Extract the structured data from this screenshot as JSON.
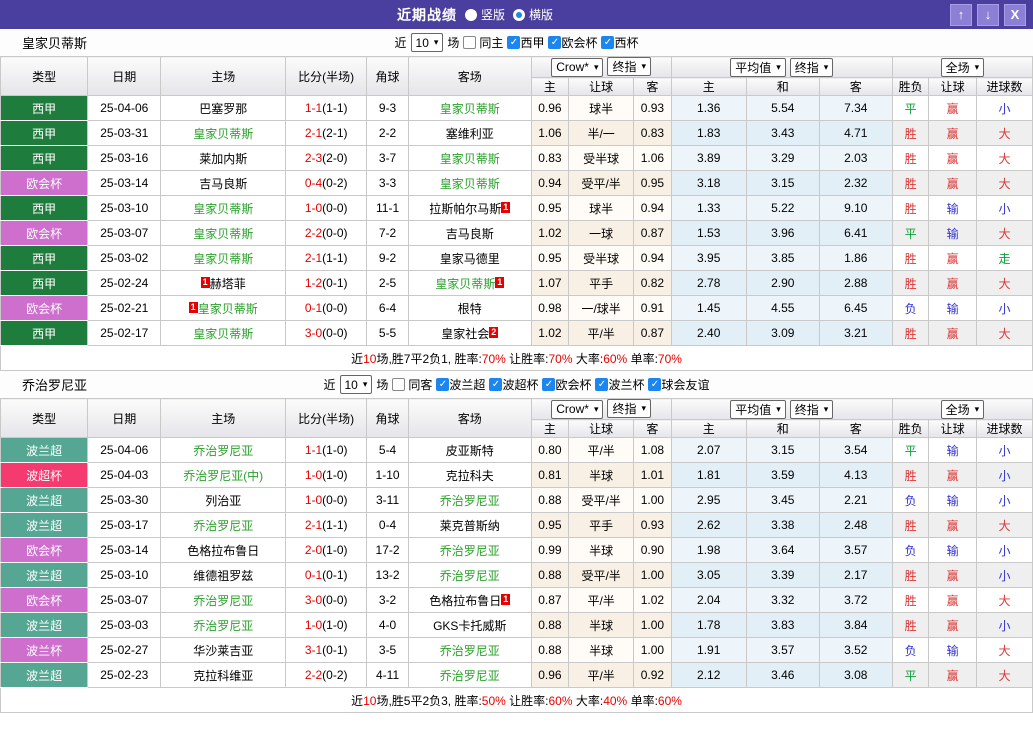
{
  "titlebar": {
    "title": "近期战绩",
    "vertical_label": "竖版",
    "horizontal_label": "横版",
    "vertical_selected": false,
    "horizontal_selected": true,
    "buttons": {
      "up": "↑",
      "down": "↓",
      "close": "X"
    }
  },
  "colors": {
    "titlebar_purple": "#4A3F9E",
    "button_purple": "#8B7FD6",
    "checkbox_blue": "#1C86EE",
    "team_highlight_green": "#2CA02C",
    "score_red": "#E60000",
    "result_red": "#D93636",
    "result_blue": "#3333CC",
    "result_green": "#0E9E3C",
    "league": {
      "西甲": "#1E7C3C",
      "欧会杯": "#CE6FCE",
      "波兰超": "#55A794",
      "波超杯": "#F43A6E",
      "波兰杯": "#CE6FCE"
    }
  },
  "columns": {
    "left": [
      "类型",
      "日期",
      "主场",
      "比分(半场)",
      "角球",
      "客场"
    ],
    "odds": [
      "主",
      "让球",
      "客"
    ],
    "avg": [
      "主",
      "和",
      "客"
    ],
    "result": [
      "胜负",
      "让球",
      "进球数"
    ]
  },
  "sections": [
    {
      "team": "皇家贝蒂斯",
      "filter": {
        "near_label": "近",
        "count": "10",
        "games_label": "场",
        "same_label": "同主",
        "same_checked": false,
        "leagues": [
          "西甲",
          "欧会杯",
          "西杯"
        ]
      },
      "selectors": {
        "odds": [
          "Crow*",
          "终指"
        ],
        "avg": [
          "平均值",
          "终指"
        ],
        "scope": [
          "全场"
        ]
      },
      "rows": [
        {
          "league": "西甲",
          "date": "25-04-06",
          "home": "巴塞罗那",
          "home_card": "",
          "home_self": false,
          "score": "1-1",
          "half": "(1-1)",
          "corner": "9-3",
          "away": "皇家贝蒂斯",
          "away_card": "",
          "away_self": true,
          "odds": [
            "0.96",
            "球半",
            "0.93"
          ],
          "avg": [
            "1.36",
            "5.54",
            "7.34"
          ],
          "res": [
            [
              "平",
              "g"
            ],
            [
              "赢",
              "r"
            ],
            [
              "小",
              "b"
            ]
          ]
        },
        {
          "league": "西甲",
          "date": "25-03-31",
          "home": "皇家贝蒂斯",
          "home_card": "",
          "home_self": true,
          "score": "2-1",
          "half": "(2-1)",
          "corner": "2-2",
          "away": "塞维利亚",
          "away_card": "",
          "away_self": false,
          "odds": [
            "1.06",
            "半/一",
            "0.83"
          ],
          "avg": [
            "1.83",
            "3.43",
            "4.71"
          ],
          "res": [
            [
              "胜",
              "r"
            ],
            [
              "赢",
              "r"
            ],
            [
              "大",
              "r"
            ]
          ]
        },
        {
          "league": "西甲",
          "date": "25-03-16",
          "home": "莱加内斯",
          "home_card": "",
          "home_self": false,
          "score": "2-3",
          "half": "(2-0)",
          "corner": "3-7",
          "away": "皇家贝蒂斯",
          "away_card": "",
          "away_self": true,
          "odds": [
            "0.83",
            "受半球",
            "1.06"
          ],
          "avg": [
            "3.89",
            "3.29",
            "2.03"
          ],
          "res": [
            [
              "胜",
              "r"
            ],
            [
              "赢",
              "r"
            ],
            [
              "大",
              "r"
            ]
          ]
        },
        {
          "league": "欧会杯",
          "date": "25-03-14",
          "home": "吉马良斯",
          "home_card": "",
          "home_self": false,
          "score": "0-4",
          "half": "(0-2)",
          "corner": "3-3",
          "away": "皇家贝蒂斯",
          "away_card": "",
          "away_self": true,
          "odds": [
            "0.94",
            "受平/半",
            "0.95"
          ],
          "avg": [
            "3.18",
            "3.15",
            "2.32"
          ],
          "res": [
            [
              "胜",
              "r"
            ],
            [
              "赢",
              "r"
            ],
            [
              "大",
              "r"
            ]
          ]
        },
        {
          "league": "西甲",
          "date": "25-03-10",
          "home": "皇家贝蒂斯",
          "home_card": "",
          "home_self": true,
          "score": "1-0",
          "half": "(0-0)",
          "corner": "11-1",
          "away": "拉斯帕尔马斯",
          "away_card": "1",
          "away_self": false,
          "odds": [
            "0.95",
            "球半",
            "0.94"
          ],
          "avg": [
            "1.33",
            "5.22",
            "9.10"
          ],
          "res": [
            [
              "胜",
              "r"
            ],
            [
              "输",
              "b"
            ],
            [
              "小",
              "b"
            ]
          ]
        },
        {
          "league": "欧会杯",
          "date": "25-03-07",
          "home": "皇家贝蒂斯",
          "home_card": "",
          "home_self": true,
          "score": "2-2",
          "half": "(0-0)",
          "corner": "7-2",
          "away": "吉马良斯",
          "away_card": "",
          "away_self": false,
          "odds": [
            "1.02",
            "一球",
            "0.87"
          ],
          "avg": [
            "1.53",
            "3.96",
            "6.41"
          ],
          "res": [
            [
              "平",
              "g"
            ],
            [
              "输",
              "b"
            ],
            [
              "大",
              "r"
            ]
          ]
        },
        {
          "league": "西甲",
          "date": "25-03-02",
          "home": "皇家贝蒂斯",
          "home_card": "",
          "home_self": true,
          "score": "2-1",
          "half": "(1-1)",
          "corner": "9-2",
          "away": "皇家马德里",
          "away_card": "",
          "away_self": false,
          "odds": [
            "0.95",
            "受半球",
            "0.94"
          ],
          "avg": [
            "3.95",
            "3.85",
            "1.86"
          ],
          "res": [
            [
              "胜",
              "r"
            ],
            [
              "赢",
              "r"
            ],
            [
              "走",
              "g"
            ]
          ]
        },
        {
          "league": "西甲",
          "date": "25-02-24",
          "home": "赫塔菲",
          "home_card": "1",
          "home_self": false,
          "score": "1-2",
          "half": "(0-1)",
          "corner": "2-5",
          "away": "皇家贝蒂斯",
          "away_card": "1",
          "away_self": true,
          "odds": [
            "1.07",
            "平手",
            "0.82"
          ],
          "avg": [
            "2.78",
            "2.90",
            "2.88"
          ],
          "res": [
            [
              "胜",
              "r"
            ],
            [
              "赢",
              "r"
            ],
            [
              "大",
              "r"
            ]
          ]
        },
        {
          "league": "欧会杯",
          "date": "25-02-21",
          "home": "皇家贝蒂斯",
          "home_card": "1",
          "home_self": true,
          "score": "0-1",
          "half": "(0-0)",
          "corner": "6-4",
          "away": "根特",
          "away_card": "",
          "away_self": false,
          "odds": [
            "0.98",
            "一/球半",
            "0.91"
          ],
          "avg": [
            "1.45",
            "4.55",
            "6.45"
          ],
          "res": [
            [
              "负",
              "b"
            ],
            [
              "输",
              "b"
            ],
            [
              "小",
              "b"
            ]
          ]
        },
        {
          "league": "西甲",
          "date": "25-02-17",
          "home": "皇家贝蒂斯",
          "home_card": "",
          "home_self": true,
          "score": "3-0",
          "half": "(0-0)",
          "corner": "5-5",
          "away": "皇家社会",
          "away_card": "2",
          "away_self": false,
          "odds": [
            "1.02",
            "平/半",
            "0.87"
          ],
          "avg": [
            "2.40",
            "3.09",
            "3.21"
          ],
          "res": [
            [
              "胜",
              "r"
            ],
            [
              "赢",
              "r"
            ],
            [
              "大",
              "r"
            ]
          ]
        }
      ],
      "summary": [
        {
          "t": "近",
          "red": false
        },
        {
          "t": "10",
          "red": true
        },
        {
          "t": "场,胜7平2负1, 胜率:",
          "red": false
        },
        {
          "t": "70%",
          "red": true
        },
        {
          "t": " 让胜率:",
          "red": false
        },
        {
          "t": "70%",
          "red": true
        },
        {
          "t": " 大率:",
          "red": false
        },
        {
          "t": "60%",
          "red": true
        },
        {
          "t": " 单率:",
          "red": false
        },
        {
          "t": "70%",
          "red": true
        }
      ]
    },
    {
      "team": "乔治罗尼亚",
      "filter": {
        "near_label": "近",
        "count": "10",
        "games_label": "场",
        "same_label": "同客",
        "same_checked": false,
        "leagues": [
          "波兰超",
          "波超杯",
          "欧会杯",
          "波兰杯",
          "球会友谊"
        ]
      },
      "selectors": {
        "odds": [
          "Crow*",
          "终指"
        ],
        "avg": [
          "平均值",
          "终指"
        ],
        "scope": [
          "全场"
        ]
      },
      "rows": [
        {
          "league": "波兰超",
          "date": "25-04-06",
          "home": "乔治罗尼亚",
          "home_card": "",
          "home_self": true,
          "score": "1-1",
          "half": "(1-0)",
          "corner": "5-4",
          "away": "皮亚斯特",
          "away_card": "",
          "away_self": false,
          "odds": [
            "0.80",
            "平/半",
            "1.08"
          ],
          "avg": [
            "2.07",
            "3.15",
            "3.54"
          ],
          "res": [
            [
              "平",
              "g"
            ],
            [
              "输",
              "b"
            ],
            [
              "小",
              "b"
            ]
          ]
        },
        {
          "league": "波超杯",
          "date": "25-04-03",
          "home": "乔治罗尼亚(中)",
          "home_card": "",
          "home_self": true,
          "score": "1-0",
          "half": "(1-0)",
          "corner": "1-10",
          "away": "克拉科夫",
          "away_card": "",
          "away_self": false,
          "odds": [
            "0.81",
            "半球",
            "1.01"
          ],
          "avg": [
            "1.81",
            "3.59",
            "4.13"
          ],
          "res": [
            [
              "胜",
              "r"
            ],
            [
              "赢",
              "r"
            ],
            [
              "小",
              "b"
            ]
          ]
        },
        {
          "league": "波兰超",
          "date": "25-03-30",
          "home": "列治亚",
          "home_card": "",
          "home_self": false,
          "score": "1-0",
          "half": "(0-0)",
          "corner": "3-11",
          "away": "乔治罗尼亚",
          "away_card": "",
          "away_self": true,
          "odds": [
            "0.88",
            "受平/半",
            "1.00"
          ],
          "avg": [
            "2.95",
            "3.45",
            "2.21"
          ],
          "res": [
            [
              "负",
              "b"
            ],
            [
              "输",
              "b"
            ],
            [
              "小",
              "b"
            ]
          ]
        },
        {
          "league": "波兰超",
          "date": "25-03-17",
          "home": "乔治罗尼亚",
          "home_card": "",
          "home_self": true,
          "score": "2-1",
          "half": "(1-1)",
          "corner": "0-4",
          "away": "莱克普斯纳",
          "away_card": "",
          "away_self": false,
          "odds": [
            "0.95",
            "平手",
            "0.93"
          ],
          "avg": [
            "2.62",
            "3.38",
            "2.48"
          ],
          "res": [
            [
              "胜",
              "r"
            ],
            [
              "赢",
              "r"
            ],
            [
              "大",
              "r"
            ]
          ]
        },
        {
          "league": "欧会杯",
          "date": "25-03-14",
          "home": "色格拉布鲁日",
          "home_card": "",
          "home_self": false,
          "score": "2-0",
          "half": "(1-0)",
          "corner": "17-2",
          "away": "乔治罗尼亚",
          "away_card": "",
          "away_self": true,
          "odds": [
            "0.99",
            "半球",
            "0.90"
          ],
          "avg": [
            "1.98",
            "3.64",
            "3.57"
          ],
          "res": [
            [
              "负",
              "b"
            ],
            [
              "输",
              "b"
            ],
            [
              "小",
              "b"
            ]
          ]
        },
        {
          "league": "波兰超",
          "date": "25-03-10",
          "home": "维德祖罗兹",
          "home_card": "",
          "home_self": false,
          "score": "0-1",
          "half": "(0-1)",
          "corner": "13-2",
          "away": "乔治罗尼亚",
          "away_card": "",
          "away_self": true,
          "odds": [
            "0.88",
            "受平/半",
            "1.00"
          ],
          "avg": [
            "3.05",
            "3.39",
            "2.17"
          ],
          "res": [
            [
              "胜",
              "r"
            ],
            [
              "赢",
              "r"
            ],
            [
              "小",
              "b"
            ]
          ]
        },
        {
          "league": "欧会杯",
          "date": "25-03-07",
          "home": "乔治罗尼亚",
          "home_card": "",
          "home_self": true,
          "score": "3-0",
          "half": "(0-0)",
          "corner": "3-2",
          "away": "色格拉布鲁日",
          "away_card": "1",
          "away_self": false,
          "odds": [
            "0.87",
            "平/半",
            "1.02"
          ],
          "avg": [
            "2.04",
            "3.32",
            "3.72"
          ],
          "res": [
            [
              "胜",
              "r"
            ],
            [
              "赢",
              "r"
            ],
            [
              "大",
              "r"
            ]
          ]
        },
        {
          "league": "波兰超",
          "date": "25-03-03",
          "home": "乔治罗尼亚",
          "home_card": "",
          "home_self": true,
          "score": "1-0",
          "half": "(1-0)",
          "corner": "4-0",
          "away": "GKS卡托威斯",
          "away_card": "",
          "away_self": false,
          "odds": [
            "0.88",
            "半球",
            "1.00"
          ],
          "avg": [
            "1.78",
            "3.83",
            "3.84"
          ],
          "res": [
            [
              "胜",
              "r"
            ],
            [
              "赢",
              "r"
            ],
            [
              "小",
              "b"
            ]
          ]
        },
        {
          "league": "波兰杯",
          "date": "25-02-27",
          "home": "华沙莱吉亚",
          "home_card": "",
          "home_self": false,
          "score": "3-1",
          "half": "(0-1)",
          "corner": "3-5",
          "away": "乔治罗尼亚",
          "away_card": "",
          "away_self": true,
          "odds": [
            "0.88",
            "半球",
            "1.00"
          ],
          "avg": [
            "1.91",
            "3.57",
            "3.52"
          ],
          "res": [
            [
              "负",
              "b"
            ],
            [
              "输",
              "b"
            ],
            [
              "大",
              "r"
            ]
          ]
        },
        {
          "league": "波兰超",
          "date": "25-02-23",
          "home": "克拉科维亚",
          "home_card": "",
          "home_self": false,
          "score": "2-2",
          "half": "(0-2)",
          "corner": "4-11",
          "away": "乔治罗尼亚",
          "away_card": "",
          "away_self": true,
          "odds": [
            "0.96",
            "平/半",
            "0.92"
          ],
          "avg": [
            "2.12",
            "3.46",
            "3.08"
          ],
          "res": [
            [
              "平",
              "g"
            ],
            [
              "赢",
              "r"
            ],
            [
              "大",
              "r"
            ]
          ]
        }
      ],
      "summary": [
        {
          "t": "近",
          "red": false
        },
        {
          "t": "10",
          "red": true
        },
        {
          "t": "场,胜5平2负3, 胜率:",
          "red": false
        },
        {
          "t": "50%",
          "red": true
        },
        {
          "t": " 让胜率:",
          "red": false
        },
        {
          "t": "60%",
          "red": true
        },
        {
          "t": " 大率:",
          "red": false
        },
        {
          "t": "40%",
          "red": true
        },
        {
          "t": " 单率:",
          "red": false
        },
        {
          "t": "60%",
          "red": true
        }
      ]
    }
  ]
}
